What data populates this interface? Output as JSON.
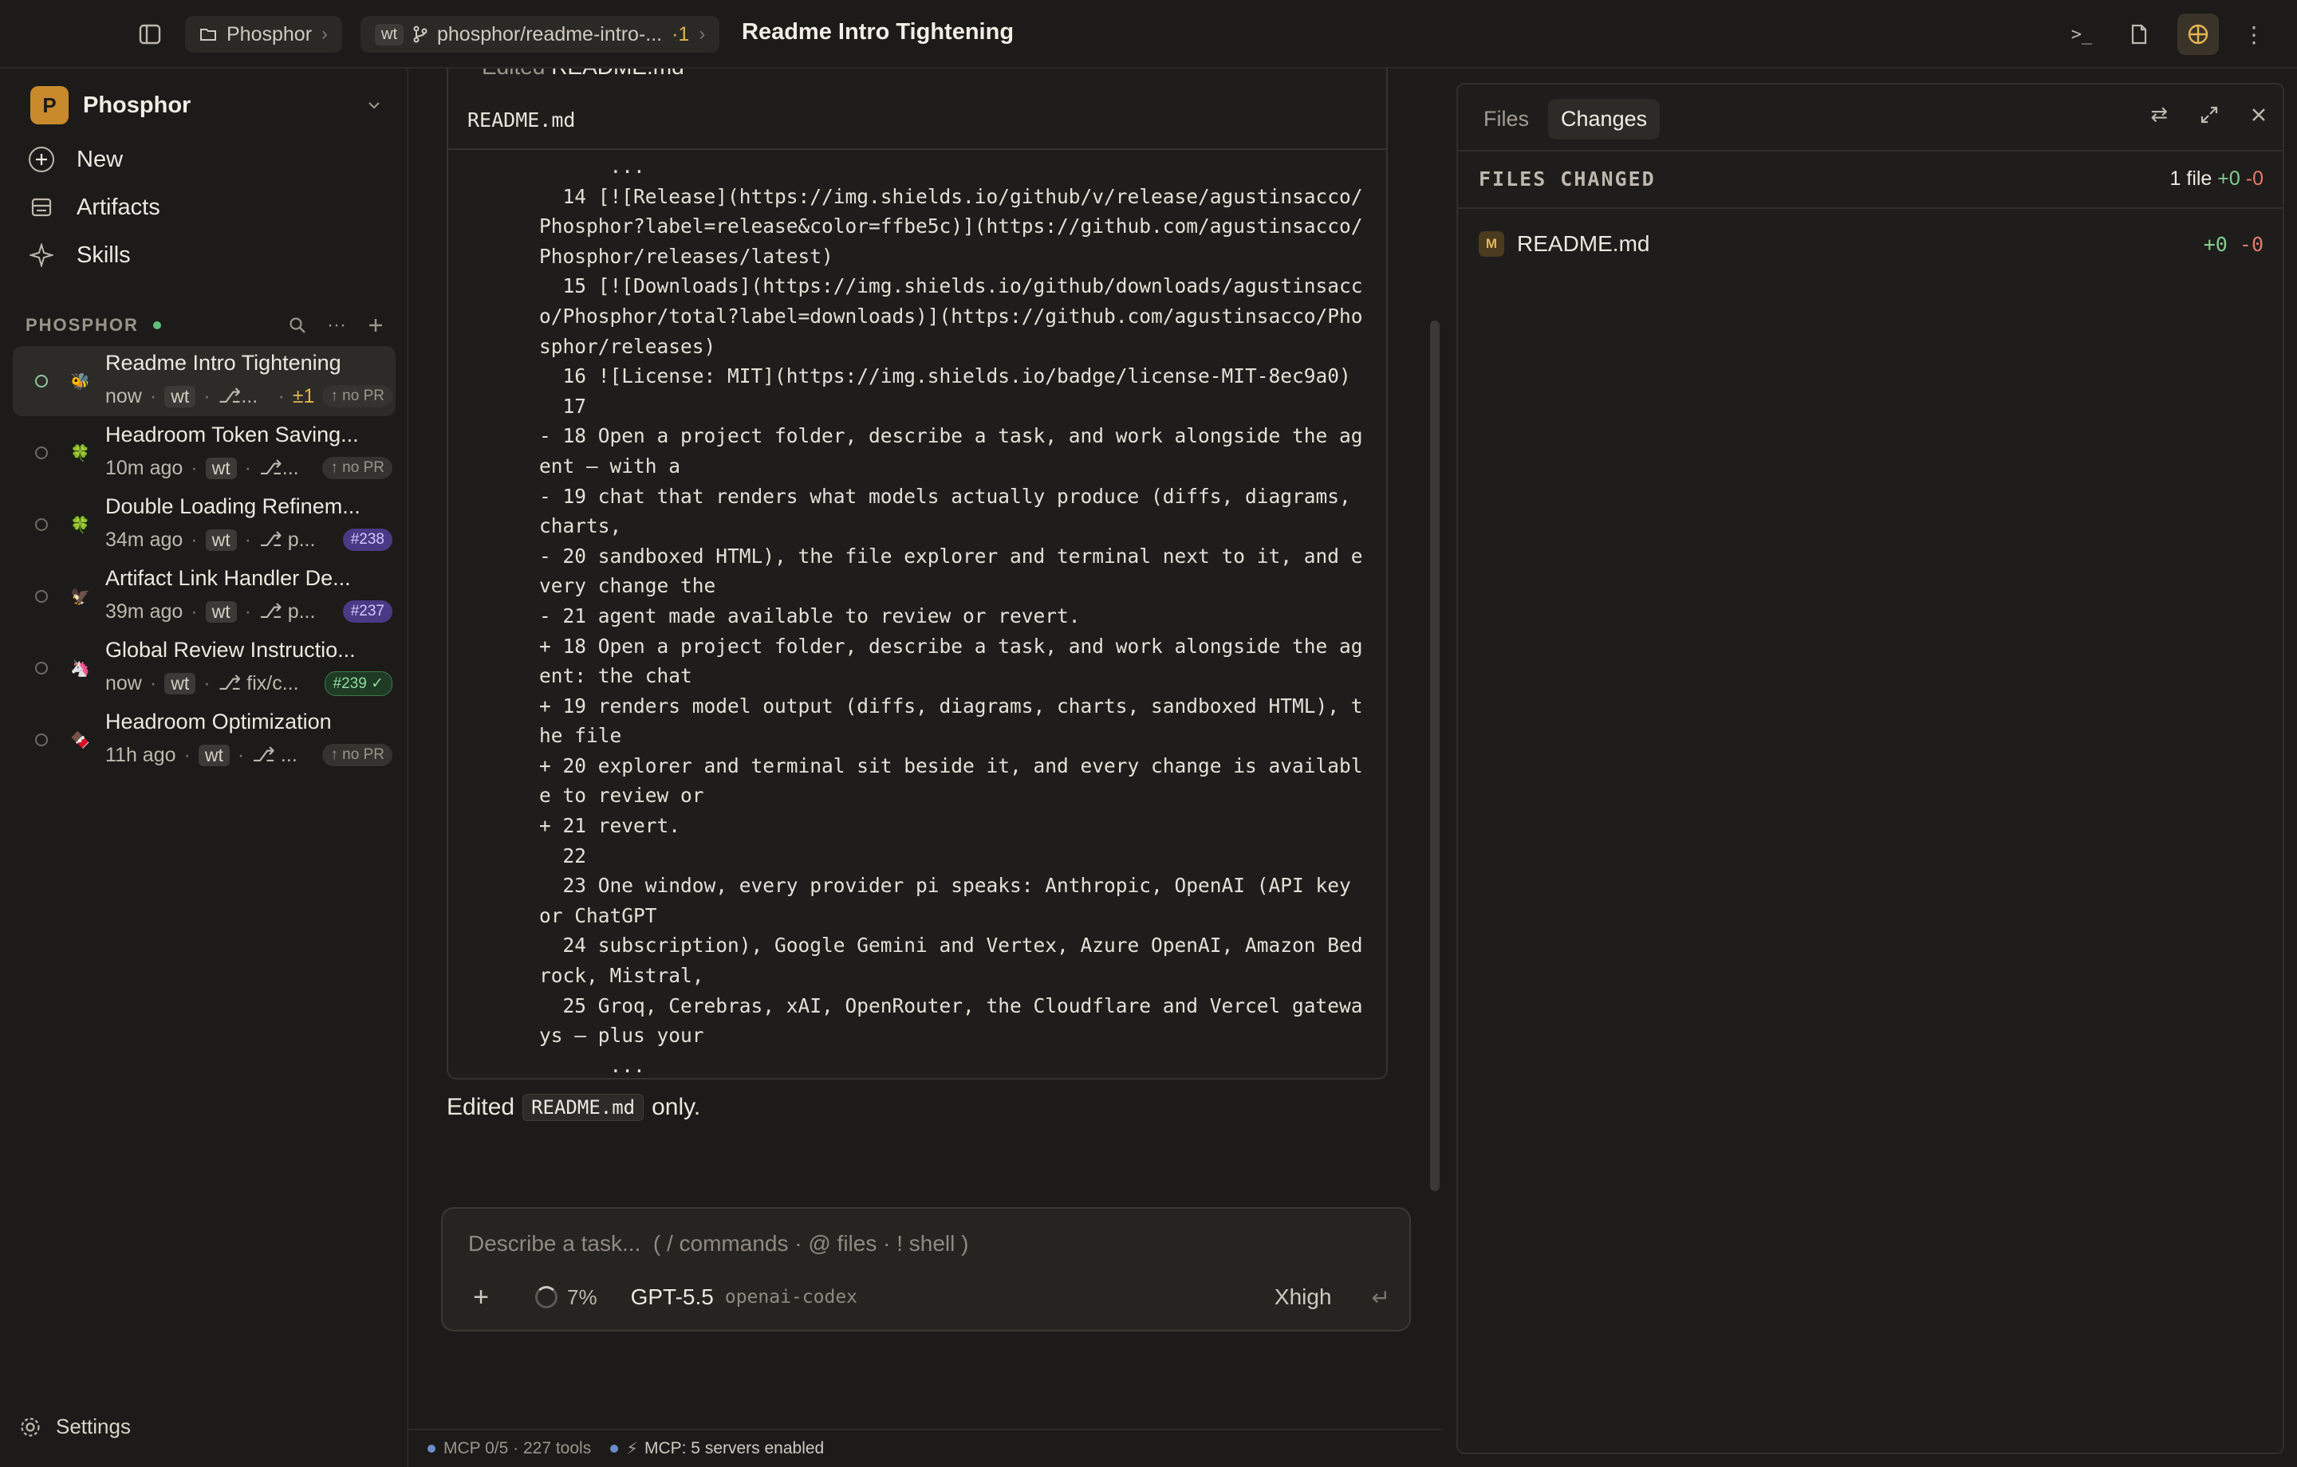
{
  "topbar": {
    "workspace_crumb": "Phosphor",
    "branch_badge": "wt",
    "branch_crumb": "phosphor/readme-intro-...",
    "branch_ahead": "·1",
    "title": "Readme Intro Tightening"
  },
  "sidebar": {
    "workspace_initial": "P",
    "workspace_name": "Phosphor",
    "nav": [
      {
        "label": "New",
        "icon": "plus-circle-icon"
      },
      {
        "label": "Artifacts",
        "icon": "artifacts-icon"
      },
      {
        "label": "Skills",
        "icon": "sparkle-icon"
      }
    ],
    "section_title": "PHOSPHOR",
    "sessions": [
      {
        "emoji": "🐝",
        "title": "Readme Intro Tightening",
        "time": "now",
        "wt": "wt",
        "branch": "⎇...",
        "extra": "±1",
        "pill": "↑ no PR",
        "pill_type": "nopr"
      },
      {
        "emoji": "🍀",
        "title": "Headroom Token Saving...",
        "time": "10m ago",
        "wt": "wt",
        "branch": "⎇...",
        "extra": "",
        "pill": "↑ no PR",
        "pill_type": "nopr"
      },
      {
        "emoji": "🍀",
        "title": "Double Loading Refinem...",
        "time": "34m ago",
        "wt": "wt",
        "branch": "⎇ p...",
        "extra": "",
        "pill": "#238",
        "pill_type": "num"
      },
      {
        "emoji": "🦅",
        "title": "Artifact Link Handler De...",
        "time": "39m ago",
        "wt": "wt",
        "branch": "⎇ p...",
        "extra": "",
        "pill": "#237",
        "pill_type": "num"
      },
      {
        "emoji": "🦄",
        "title": "Global Review Instructio...",
        "time": "now",
        "wt": "wt",
        "branch": "⎇ fix/c...",
        "extra": "",
        "pill": "#239 ✓",
        "pill_type": "numok"
      },
      {
        "emoji": "🍫",
        "title": "Headroom Optimization",
        "time": "11h ago",
        "wt": "wt",
        "branch": "⎇ ...",
        "extra": "",
        "pill": "↑ no PR",
        "pill_type": "nopr"
      }
    ],
    "settings_label": "Settings"
  },
  "main": {
    "card_peek": "Edited",
    "card_peek_file": "README.md",
    "card_file": "README.md",
    "code_lines": [
      "      ...",
      "  14 [![Release](https://img.shields.io/github/v/release/agustinsacco/",
      "Phosphor?label=release&color=ffbe5c)](https://github.com/agustinsacco/",
      "Phosphor/releases/latest)",
      "  15 [![Downloads](https://img.shields.io/github/downloads/agustinsacc",
      "o/Phosphor/total?label=downloads)](https://github.com/agustinsacco/Pho",
      "sphor/releases)",
      "  16 ![License: MIT](https://img.shields.io/badge/license-MIT-8ec9a0)",
      "  17",
      "- 18 Open a project folder, describe a task, and work alongside the ag",
      "ent — with a",
      "- 19 chat that renders what models actually produce (diffs, diagrams,",
      "charts,",
      "- 20 sandboxed HTML), the file explorer and terminal next to it, and e",
      "very change the",
      "- 21 agent made available to review or revert.",
      "+ 18 Open a project folder, describe a task, and work alongside the ag",
      "ent: the chat",
      "+ 19 renders model output (diffs, diagrams, charts, sandboxed HTML), t",
      "he file",
      "+ 20 explorer and terminal sit beside it, and every change is availabl",
      "e to review or",
      "+ 21 revert.",
      "  22",
      "  23 One window, every provider pi speaks: Anthropic, OpenAI (API key",
      "or ChatGPT",
      "  24 subscription), Google Gemini and Vertex, Azure OpenAI, Amazon Bed",
      "rock, Mistral,",
      "  25 Groq, Cerebras, xAI, OpenRouter, the Cloudflare and Vercel gatewa",
      "ys — plus your",
      "      ..."
    ],
    "edited_prefix": "Edited",
    "edited_file": "README.md",
    "edited_suffix": "only."
  },
  "composer": {
    "placeholder": "Describe a task...  ( / commands · @ files · ! shell )",
    "context_pct": "7%",
    "model": "GPT-5.5",
    "provider": "openai-codex",
    "effort": "Xhigh",
    "send_icon": "↵"
  },
  "statusbar": {
    "mcp_tools": "MCP 0/5 · 227 tools",
    "mcp_servers": "MCP: 5 servers enabled"
  },
  "right_panel": {
    "tabs": [
      "Files",
      "Changes"
    ],
    "active_tab": "Changes",
    "section_title": "FILES CHANGED",
    "count_label": "1 file",
    "count_plus": "+0",
    "count_minus": "-0",
    "files": [
      {
        "badge": "M",
        "name": "README.md",
        "plus": "+0",
        "minus": "-0"
      }
    ]
  },
  "colors": {
    "accent": "#c98a2b",
    "plus": "#7fcf8f",
    "minus": "#e57a6a",
    "pr_badge": "#4a3a86"
  }
}
